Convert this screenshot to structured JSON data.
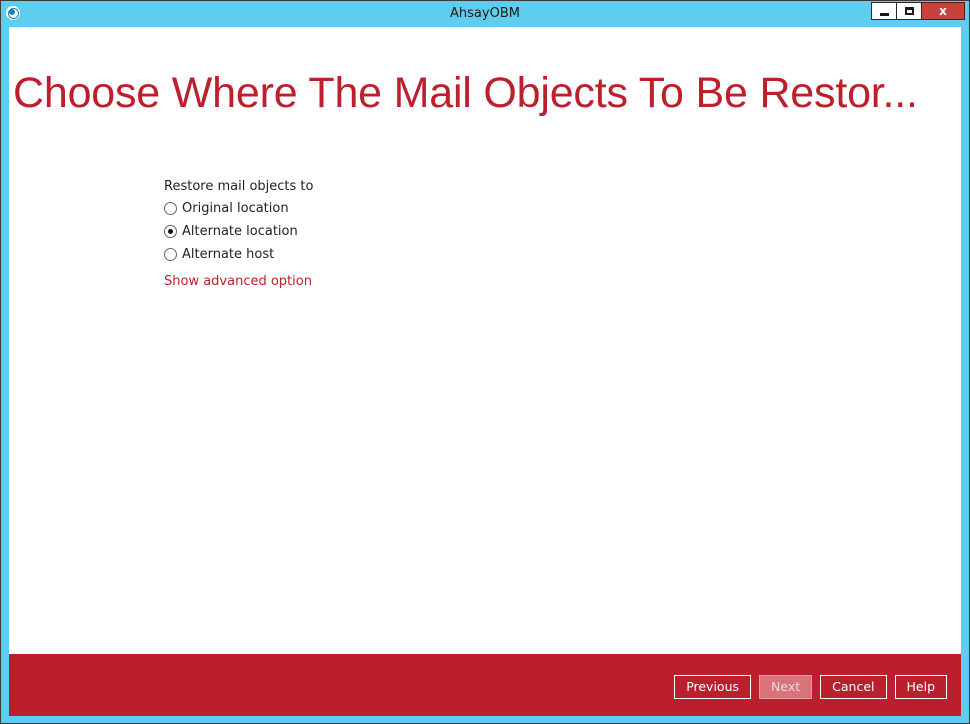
{
  "window": {
    "title": "AhsayOBM",
    "icon": "ahsay-app-icon",
    "controls": {
      "minimize_icon": "minimize-icon",
      "maximize_icon": "maximize-icon",
      "close_label": "x"
    }
  },
  "page": {
    "title": "Choose Where The Mail Objects To Be Restor..."
  },
  "restore": {
    "label": "Restore mail objects to",
    "options": [
      {
        "label": "Original location",
        "selected": false
      },
      {
        "label": "Alternate location",
        "selected": true
      },
      {
        "label": "Alternate host",
        "selected": false
      }
    ],
    "advanced_link": "Show advanced option"
  },
  "footer": {
    "previous_label": "Previous",
    "next_label": "Next",
    "next_disabled": true,
    "cancel_label": "Cancel",
    "help_label": "Help"
  },
  "colors": {
    "titlebar": "#5fcdee",
    "accent": "#be1f2c",
    "footer": "#bb1e2c"
  }
}
